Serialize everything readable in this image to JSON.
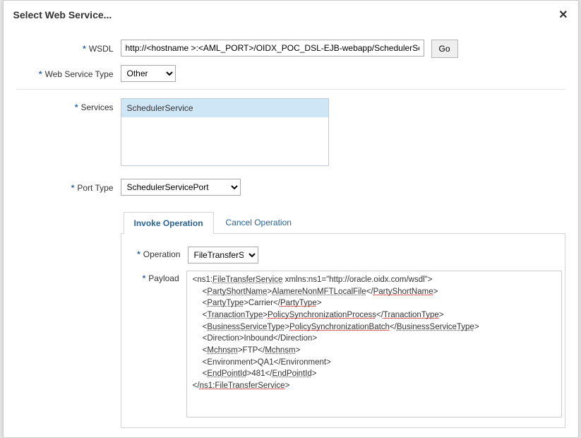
{
  "title": "Select Web Service...",
  "fields": {
    "wsdl": {
      "label": "WSDL",
      "value": "http://<hostname >:<AML_PORT>/OIDX_POC_DSL-EJB-webapp/SchedulerService"
    },
    "go_label": "Go",
    "web_service_type": {
      "label": "Web Service Type",
      "value": "Other"
    },
    "services": {
      "label": "Services",
      "items": [
        "SchedulerService"
      ]
    },
    "port_type": {
      "label": "Port Type",
      "value": "SchedulerServicePort"
    }
  },
  "tabs": {
    "invoke": "Invoke Operation",
    "cancel": "Cancel Operation"
  },
  "operation": {
    "label": "Operation",
    "value": "FileTransferService"
  },
  "payload": {
    "label": "Payload",
    "line1_a": "<ns1:",
    "line1_b": "FileTransferService",
    "line1_c": " xmlns:ns1=\"http://oracle.oidx.com/wsdl\">",
    "line2_a": "<",
    "line2_b": "PartyShortName",
    "line2_c": ">",
    "line2_d": "AlamereNonMFTLocalFile",
    "line2_e": "</",
    "line2_f": "PartyShortName",
    "line2_g": ">",
    "line3_a": "<",
    "line3_b": "PartyType",
    "line3_c": ">Carrier</",
    "line3_d": "PartyType",
    "line3_e": ">",
    "line4_a": "<",
    "line4_b": "TranactionType",
    "line4_c": ">",
    "line4_d": "PolicySynchronizationProcess",
    "line4_e": "</",
    "line4_f": "TranactionType",
    "line4_g": ">",
    "line5_a": "<",
    "line5_b": "BusinessServiceType",
    "line5_c": ">",
    "line5_d": "PolicySynchronizationBatch",
    "line5_e": "</",
    "line5_f": "BusinessServiceType",
    "line5_g": ">",
    "line6": "<Direction>Inbound</Direction>",
    "line7_a": "<",
    "line7_b": "Mchnsm",
    "line7_c": ">FTP</",
    "line7_d": "Mchnsm",
    "line7_e": ">",
    "line8": "<Environment>QA1</Environment>",
    "line9_a": "<",
    "line9_b": "EndPointId",
    "line9_c": ">481</",
    "line9_d": "EndPointId",
    "line9_e": ">",
    "line10_a": "</",
    "line10_b": "ns1:FileTransferService",
    "line10_c": ">"
  }
}
